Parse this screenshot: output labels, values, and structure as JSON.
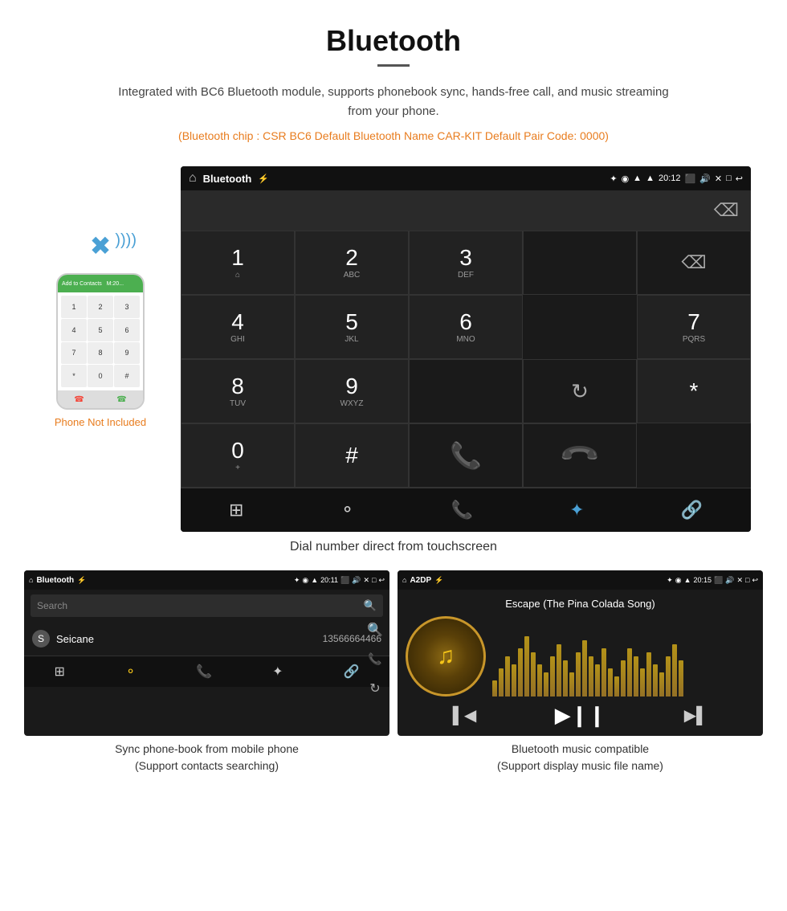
{
  "page": {
    "title": "Bluetooth",
    "description": "Integrated with BC6 Bluetooth module, supports phonebook sync, hands-free call, and music streaming from your phone.",
    "specs": "(Bluetooth chip : CSR BC6    Default Bluetooth Name CAR-KIT    Default Pair Code: 0000)",
    "phone_not_included": "Phone Not Included",
    "main_caption": "Dial number direct from touchscreen",
    "bottom_left_caption_line1": "Sync phone-book from mobile phone",
    "bottom_left_caption_line2": "(Support contacts searching)",
    "bottom_right_caption_line1": "Bluetooth music compatible",
    "bottom_right_caption_line2": "(Support display music file name)"
  },
  "dialpad": {
    "title": "Bluetooth",
    "time": "20:12",
    "keys": [
      {
        "num": "1",
        "letters": "⌂"
      },
      {
        "num": "2",
        "letters": "ABC"
      },
      {
        "num": "3",
        "letters": "DEF"
      },
      {
        "num": "4",
        "letters": "GHI"
      },
      {
        "num": "5",
        "letters": "JKL"
      },
      {
        "num": "6",
        "letters": "MNO"
      },
      {
        "num": "7",
        "letters": "PQRS"
      },
      {
        "num": "8",
        "letters": "TUV"
      },
      {
        "num": "9",
        "letters": "WXYZ"
      },
      {
        "num": "*",
        "letters": ""
      },
      {
        "num": "0",
        "letters": "+"
      },
      {
        "num": "#",
        "letters": ""
      }
    ]
  },
  "phonebook": {
    "title": "Bluetooth",
    "time": "20:11",
    "search_placeholder": "Search",
    "contact_letter": "S",
    "contact_name": "Seicane",
    "contact_number": "13566664466"
  },
  "music": {
    "title": "A2DP",
    "time": "20:15",
    "song_title": "Escape (The Pina Colada Song)"
  },
  "icons": {
    "home": "⌂",
    "bluetooth": "✦",
    "usb": "⚡",
    "signal": "▲",
    "wifi": "▲",
    "battery": "▮",
    "camera": "📷",
    "volume": "🔊",
    "window": "□",
    "back": "↩",
    "dialpad": "⊞",
    "person": "♟",
    "phone": "📞",
    "bt": "✦",
    "link": "⛓",
    "search_icon": "🔍",
    "reload": "↻",
    "backspace": "⌫",
    "prev": "⏮",
    "play_pause": "⏯",
    "next": "⏭"
  }
}
